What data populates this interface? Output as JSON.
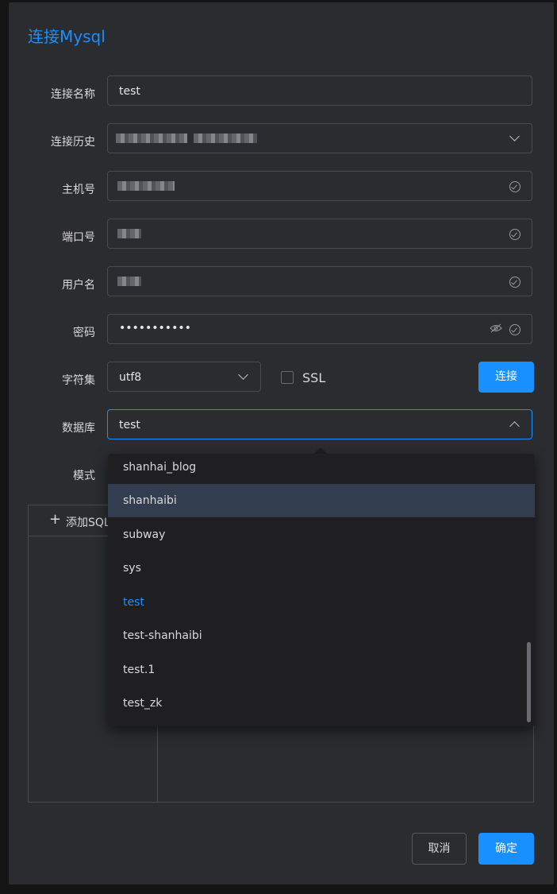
{
  "dialog": {
    "title": "连接Mysql"
  },
  "form": {
    "name_label": "连接名称",
    "name_value": "test",
    "history_label": "连接历史",
    "host_label": "主机号",
    "port_label": "端口号",
    "user_label": "用户名",
    "password_label": "密码",
    "password_value": "•••••••••••",
    "charset_label": "字符集",
    "charset_value": "utf8",
    "ssl_label": "SSL",
    "connect_label": "连接",
    "database_label": "数据库",
    "database_value": "test",
    "schema_label": "模式"
  },
  "panel": {
    "add_sql_label": "添加SQL"
  },
  "dropdown": {
    "options": [
      "shanhai_blog",
      "shanhaibi",
      "subway",
      "sys",
      "test",
      "test-shanhaibi",
      "test.1",
      "test_zk"
    ],
    "hovered": "shanhaibi",
    "selected": "test"
  },
  "footer": {
    "cancel_label": "取消",
    "ok_label": "确定"
  },
  "colors": {
    "accent": "#1890ff",
    "background": "#2b2c30",
    "dropdown_bg": "#1f1f22",
    "hover_bg": "#333d50"
  }
}
